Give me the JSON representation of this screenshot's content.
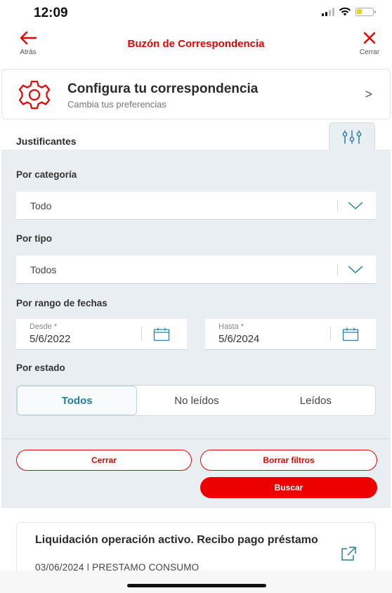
{
  "status_bar": {
    "time": "12:09"
  },
  "header": {
    "title": "Buzón de Correspondencia",
    "back_label": "Atrás",
    "close_label": "Cerrar"
  },
  "config_card": {
    "title": "Configura tu correspondencia",
    "subtitle": "Cambia tus preferencias",
    "chevron": ">"
  },
  "section": {
    "title": "Justificantes"
  },
  "filters": {
    "category": {
      "label": "Por categoría",
      "value": "Todo"
    },
    "type": {
      "label": "Por tipo",
      "value": "Todos"
    },
    "date_range": {
      "label": "Por rango de fechas",
      "from_caption": "Desde *",
      "from_value": "5/6/2022",
      "to_caption": "Hasta *",
      "to_value": "5/6/2024"
    },
    "state": {
      "label": "Por estado",
      "options": [
        "Todos",
        "No leídos",
        "Leídos"
      ],
      "selected": "Todos"
    }
  },
  "actions": {
    "close_label": "Cerrar",
    "clear_label": "Borrar filtros",
    "search_label": "Buscar"
  },
  "result": {
    "title": "Liquidación operación activo. Recibo pago préstamo",
    "meta": "03/06/2024 | PRESTAMO CONSUMO"
  },
  "colors": {
    "brand_red": "#ec0000",
    "accent_teal": "#257fa4",
    "panel_bg": "#e9eef2"
  }
}
